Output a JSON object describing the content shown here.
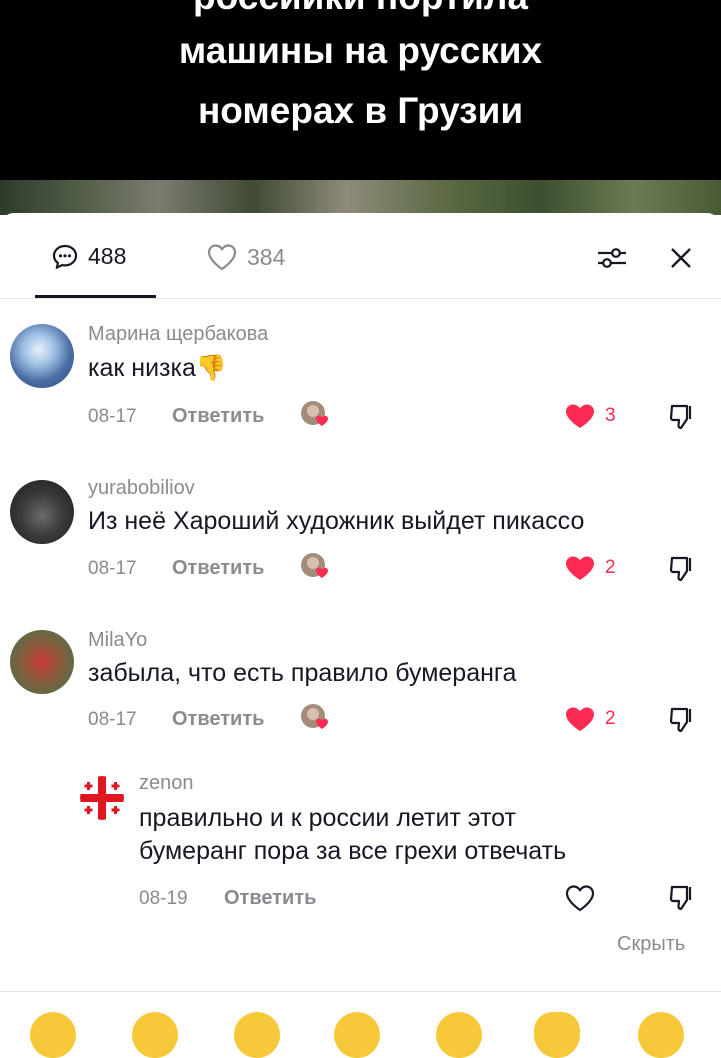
{
  "video": {
    "caption_lines": [
      "российки портила",
      "машины на русских",
      "номерах в Грузии"
    ]
  },
  "tabs": {
    "comments_count": "488",
    "likes_count": "384"
  },
  "comments": [
    {
      "username": "Марина щербакова",
      "text": "как низка👎",
      "date": "08-17",
      "reply_label": "Ответить",
      "likes": "3",
      "liked": true
    },
    {
      "username": "yurabobiliov",
      "text": "Из неё Хароший художник выйдет пикассо",
      "date": "08-17",
      "reply_label": "Ответить",
      "likes": "2",
      "liked": true
    },
    {
      "username": "MilaYo",
      "text": "забыла, что есть правило бумеранга",
      "date": "08-17",
      "reply_label": "Ответить",
      "likes": "2",
      "liked": true
    }
  ],
  "reply": {
    "username": "zenon",
    "text_line1": "правильно и к россии летит этот",
    "text_line2": "бумеранг пора за все грехи отвечать",
    "date": "08-19",
    "reply_label": "Ответить",
    "liked": false
  },
  "hide_label": "Скрыть",
  "colors": {
    "accent": "#fe2c55",
    "muted": "#8a8b91",
    "text": "#161823"
  }
}
